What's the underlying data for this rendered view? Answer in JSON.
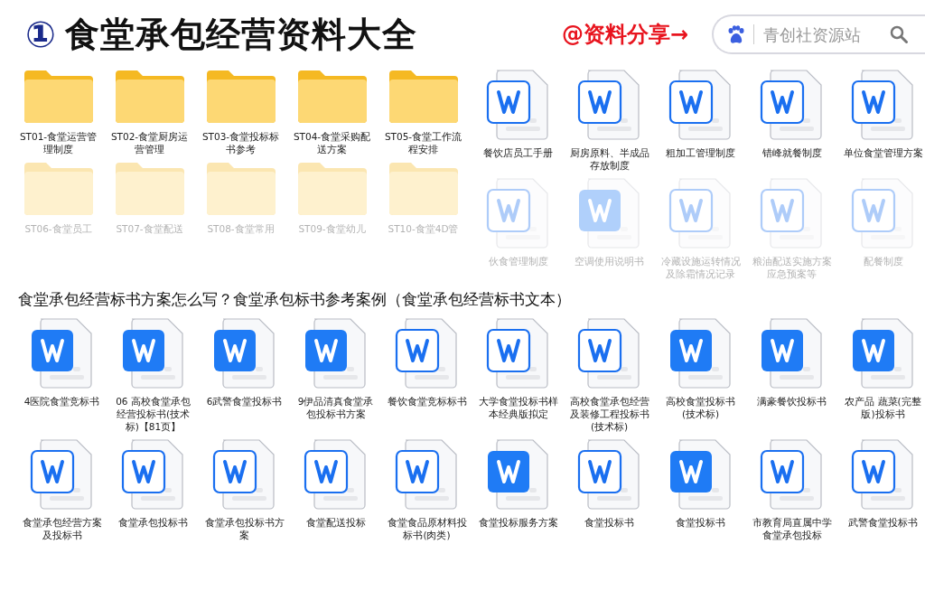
{
  "header": {
    "number": "①",
    "title": "食堂承包经营资料大全",
    "share_label": "@资料分享→",
    "search": {
      "placeholder": "青创社资源站"
    }
  },
  "folder_panel": {
    "rows": [
      {
        "faded": false,
        "items": [
          {
            "name": "ST01-食堂运营管理制度",
            "kind": "folder"
          },
          {
            "name": "ST02-食堂厨房运营管理",
            "kind": "folder"
          },
          {
            "name": "ST03-食堂投标标书参考",
            "kind": "folder"
          },
          {
            "name": "ST04-食堂采购配送方案",
            "kind": "folder"
          },
          {
            "name": "ST05-食堂工作流程安排",
            "kind": "folder"
          }
        ]
      },
      {
        "faded": true,
        "items": [
          {
            "name": "ST06-食堂员工",
            "kind": "folder"
          },
          {
            "name": "ST07-食堂配送",
            "kind": "folder"
          },
          {
            "name": "ST08-食堂常用",
            "kind": "folder"
          },
          {
            "name": "ST09-食堂幼儿",
            "kind": "folder"
          },
          {
            "name": "ST10-食堂4D管",
            "kind": "folder"
          }
        ]
      }
    ]
  },
  "document_panel": {
    "rows": [
      {
        "faded": false,
        "items": [
          {
            "name": "餐饮店员工手册",
            "kind": "doc-outline"
          },
          {
            "name": "厨房原料、半成品存放制度",
            "kind": "doc-outline"
          },
          {
            "name": "粗加工管理制度",
            "kind": "doc-outline"
          },
          {
            "name": "错峰就餐制度",
            "kind": "doc-outline"
          },
          {
            "name": "单位食堂管理方案",
            "kind": "doc-outline"
          }
        ]
      },
      {
        "faded": true,
        "items": [
          {
            "name": "伙食管理制度",
            "kind": "doc-outline"
          },
          {
            "name": "空调使用说明书",
            "kind": "doc-solid"
          },
          {
            "name": "冷藏设施运转情况及除霜情况记录",
            "kind": "doc-outline"
          },
          {
            "name": "粮油配送实施方案应急预案等",
            "kind": "doc-outline"
          },
          {
            "name": "配餐制度",
            "kind": "doc-outline"
          }
        ]
      }
    ]
  },
  "caption": "食堂承包经营标书方案怎么写？食堂承包标书参考案例（食堂承包经营标书文本）",
  "file_panel": {
    "rows": [
      {
        "faded": false,
        "items": [
          {
            "name": "4医院食堂竞标书",
            "kind": "doc-solid"
          },
          {
            "name": "06 高校食堂承包经营投标书(技术标)【81页】",
            "kind": "doc-solid"
          },
          {
            "name": "6武警食堂投标书",
            "kind": "doc-solid"
          },
          {
            "name": "9伊品清真食堂承包投标书方案",
            "kind": "doc-solid"
          },
          {
            "name": "餐饮食堂竞标标书",
            "kind": "doc-outline"
          },
          {
            "name": "大学食堂投标书样本经典版拟定",
            "kind": "doc-outline"
          },
          {
            "name": "高校食堂承包经营及装修工程投标书(技术标)",
            "kind": "doc-outline"
          },
          {
            "name": "高校食堂投标书(技术标)",
            "kind": "doc-solid"
          },
          {
            "name": "满豪餐饮投标书",
            "kind": "doc-solid"
          },
          {
            "name": "农产品 蔬菜(完整版)投标书",
            "kind": "doc-solid"
          }
        ]
      },
      {
        "faded": false,
        "items": [
          {
            "name": "食堂承包经营方案及投标书",
            "kind": "doc-outline"
          },
          {
            "name": "食堂承包投标书",
            "kind": "doc-outline"
          },
          {
            "name": "食堂承包投标书方案",
            "kind": "doc-outline"
          },
          {
            "name": "食堂配送投标",
            "kind": "doc-outline"
          },
          {
            "name": "食堂食品原材料投标书(肉类)",
            "kind": "doc-outline"
          },
          {
            "name": "食堂投标服务方案",
            "kind": "doc-solid"
          },
          {
            "name": "食堂投标书",
            "kind": "doc-outline"
          },
          {
            "name": "食堂投标书",
            "kind": "doc-solid"
          },
          {
            "name": "市教育局直属中学食堂承包投标",
            "kind": "doc-outline"
          },
          {
            "name": "武警食堂投标书",
            "kind": "doc-outline"
          }
        ]
      }
    ]
  }
}
